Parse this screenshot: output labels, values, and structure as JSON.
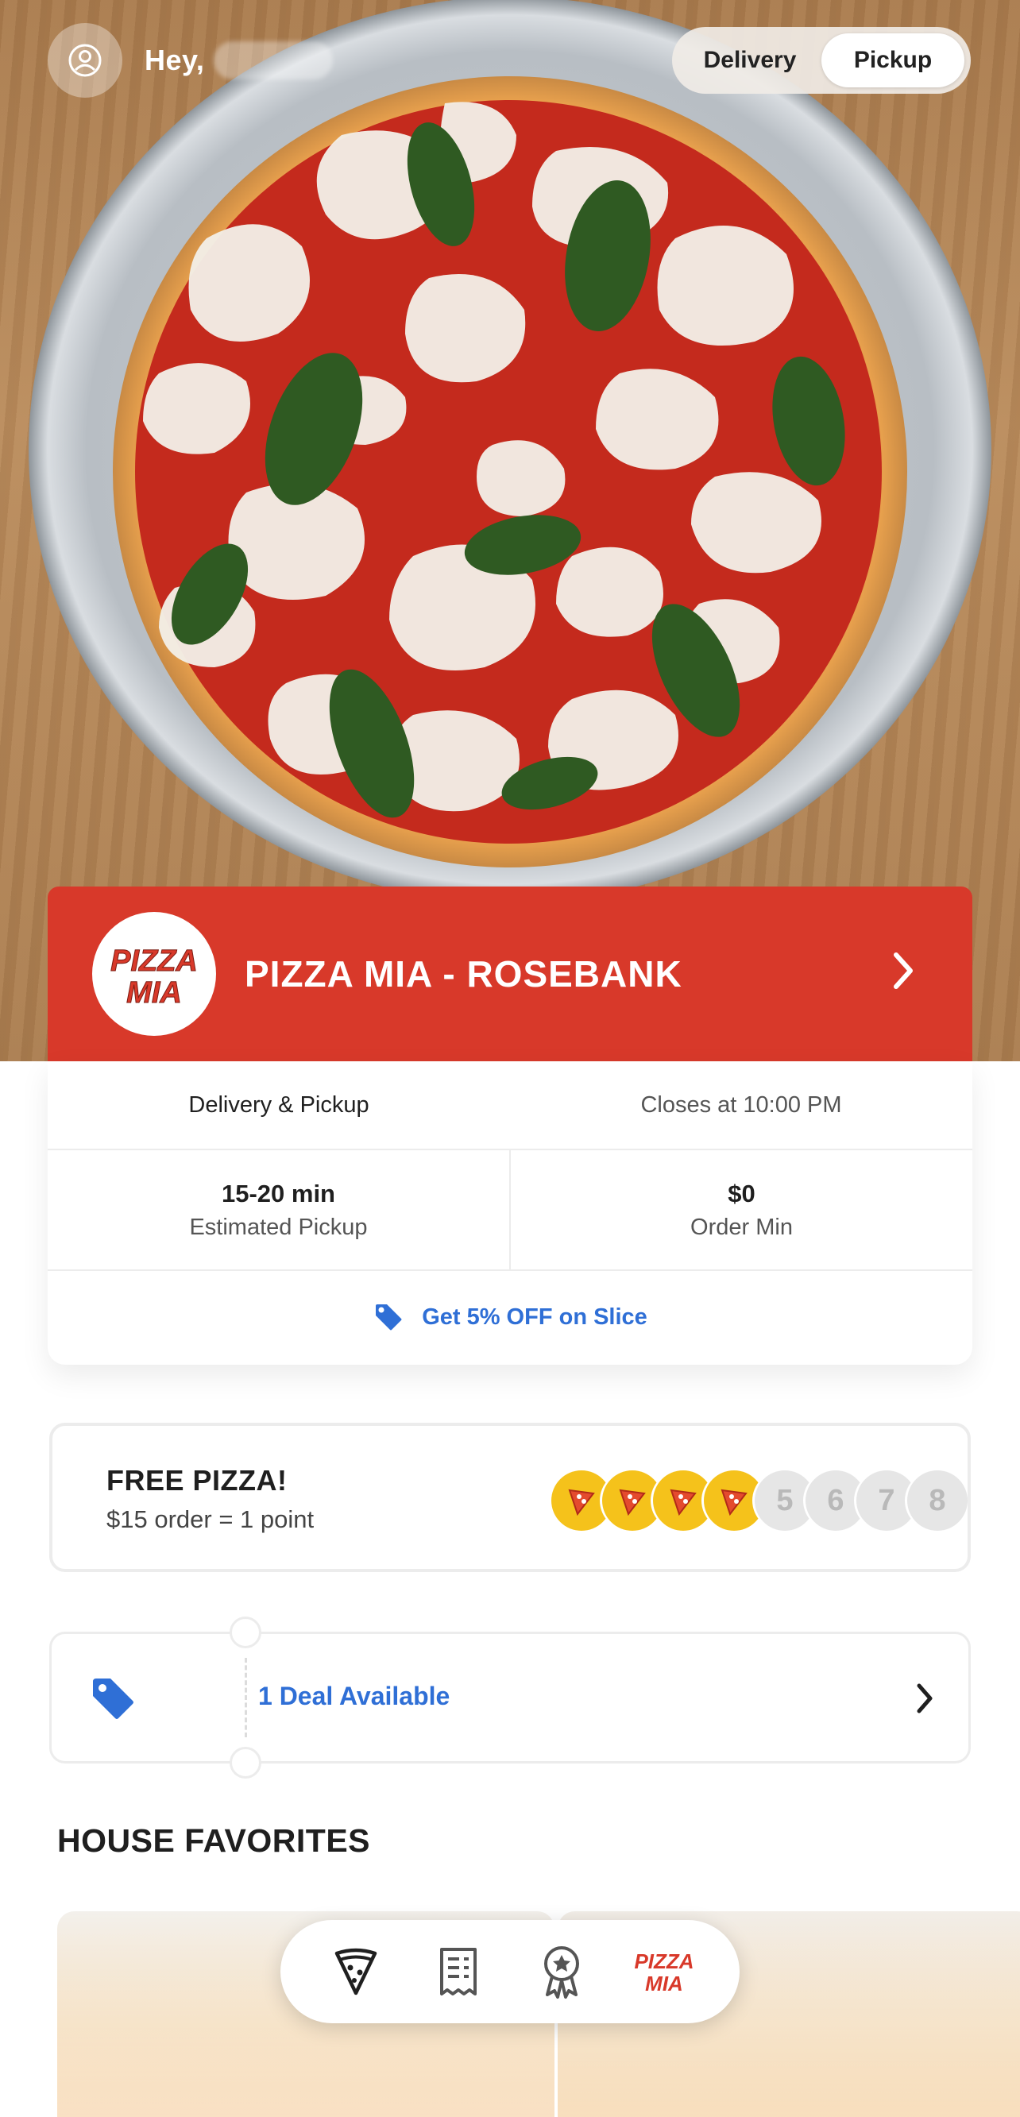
{
  "header": {
    "greeting": "Hey,",
    "avatar_icon": "user-circle-icon",
    "modes": [
      {
        "label": "Delivery",
        "active": false
      },
      {
        "label": "Pickup",
        "active": true
      }
    ]
  },
  "store": {
    "logo_text_line1": "PIZZA",
    "logo_text_line2": "MIA",
    "name": "PIZZA MIA - ROSEBANK",
    "brand_color": "#d8392a"
  },
  "info": {
    "service": "Delivery & Pickup",
    "hours": "Closes at 10:00 PM",
    "estimate_value": "15-20 min",
    "estimate_label": "Estimated Pickup",
    "order_min_value": "$0",
    "order_min_label": "Order Min",
    "promo": "Get 5% OFF on Slice",
    "accent": "#2f6fd6"
  },
  "loyalty": {
    "title": "FREE PIZZA!",
    "subtitle": "$15 order = 1 point",
    "points_earned": 4,
    "points_total": 8,
    "remaining_labels": [
      "5",
      "6",
      "7",
      "8"
    ]
  },
  "deal": {
    "label": "1 Deal Available",
    "icon": "tag-icon"
  },
  "sections": {
    "house_favorites": "HOUSE FAVORITES"
  },
  "nav": {
    "items": [
      {
        "name": "menu",
        "icon": "pizza-slice-icon"
      },
      {
        "name": "orders",
        "icon": "receipt-icon"
      },
      {
        "name": "rewards",
        "icon": "award-icon"
      },
      {
        "name": "brand",
        "icon": "pizza-mia-logo"
      }
    ],
    "logo_line1": "PIZZA",
    "logo_line2": "MIA"
  }
}
